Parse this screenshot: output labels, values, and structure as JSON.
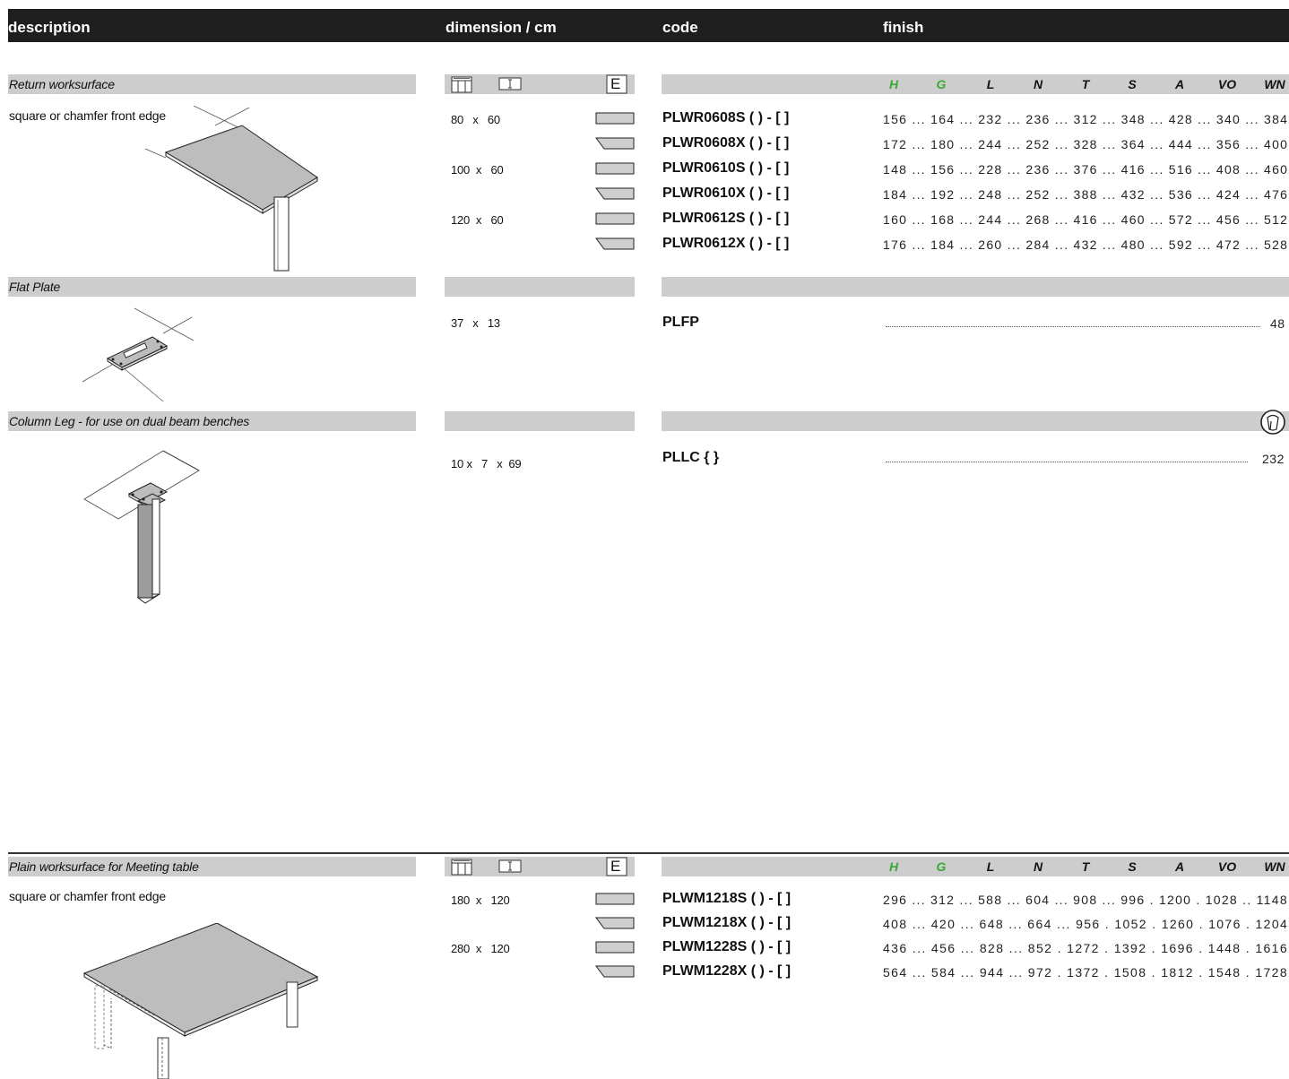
{
  "header": {
    "description": "description",
    "dimension": "dimension / cm",
    "code": "code",
    "finish": "finish"
  },
  "finish_codes": [
    {
      "label": "H",
      "color": "#39a935"
    },
    {
      "label": "G",
      "color": "#39a935"
    },
    {
      "label": "L",
      "color": "#111111"
    },
    {
      "label": "N",
      "color": "#111111"
    },
    {
      "label": "T",
      "color": "#111111"
    },
    {
      "label": "S",
      "color": "#111111"
    },
    {
      "label": "A",
      "color": "#111111"
    },
    {
      "label": "VO",
      "color": "#111111"
    },
    {
      "label": "WN",
      "color": "#111111"
    }
  ],
  "icons": {
    "edge_header_letter": "E"
  },
  "sections": {
    "return": {
      "title": "Return worksurface",
      "subtitle": "square or chamfer front edge",
      "rows": [
        {
          "dim": "80   x   60",
          "edge": "square",
          "code": "PLWR0608S ( ) - [ ]",
          "prices": "156 ... 164 ... 232 ... 236 ... 312 ... 348 ... 428 ... 340 ... 384"
        },
        {
          "dim": "",
          "edge": "chamfer",
          "code": "PLWR0608X ( ) - [ ]",
          "prices": "172 ... 180 ... 244 ... 252 ... 328 ... 364 ... 444 ... 356 ... 400"
        },
        {
          "dim": "100  x   60",
          "edge": "square",
          "code": "PLWR0610S ( ) - [ ]",
          "prices": "148 ... 156 ... 228 ... 236 ... 376 ... 416 ... 516 ... 408 ... 460"
        },
        {
          "dim": "",
          "edge": "chamfer",
          "code": "PLWR0610X ( ) - [ ]",
          "prices": "184 ... 192 ... 248 ... 252 ... 388 ... 432 ... 536 ... 424 ... 476"
        },
        {
          "dim": "120  x   60",
          "edge": "square",
          "code": "PLWR0612S ( ) - [ ]",
          "prices": "160 ... 168 ... 244 ... 268 ... 416 ... 460 ... 572 ... 456 ... 512"
        },
        {
          "dim": "",
          "edge": "chamfer",
          "code": "PLWR0612X ( ) - [ ]",
          "prices": "176 ... 184 ... 260 ... 284 ... 432 ... 480 ... 592 ... 472 ... 528"
        }
      ]
    },
    "flat_plate": {
      "title": "Flat Plate",
      "dim": "37   x   13",
      "code": "PLFP",
      "price": "48"
    },
    "column_leg": {
      "title": "Column Leg - for use on dual beam benches",
      "dim": "10 x   7   x  69",
      "code": "PLLC { }",
      "price": "232"
    },
    "meeting": {
      "title": "Plain worksurface for Meeting table",
      "subtitle": "square or chamfer front edge",
      "rows": [
        {
          "dim": "180  x   120",
          "edge": "square",
          "code": "PLWM1218S ( ) - [ ]",
          "prices": "296 ... 312 ... 588 ... 604 ... 908 ... 996 . 1200 . 1028 .. 1148"
        },
        {
          "dim": "",
          "edge": "chamfer",
          "code": "PLWM1218X ( ) - [ ]",
          "prices": "408 ... 420 ... 648 ... 664 ... 956 . 1052 . 1260 . 1076 . 1204"
        },
        {
          "dim": "280  x   120",
          "edge": "square",
          "code": "PLWM1228S ( ) - [ ]",
          "prices": "436 ... 456 ... 828 ... 852 . 1272 . 1392 . 1696 . 1448 . 1616"
        },
        {
          "dim": "",
          "edge": "chamfer",
          "code": "PLWM1228X ( ) - [ ]",
          "prices": "564 ... 584 ... 944 ... 972 . 1372 . 1508 . 1812 . 1548 . 1728"
        }
      ]
    }
  }
}
